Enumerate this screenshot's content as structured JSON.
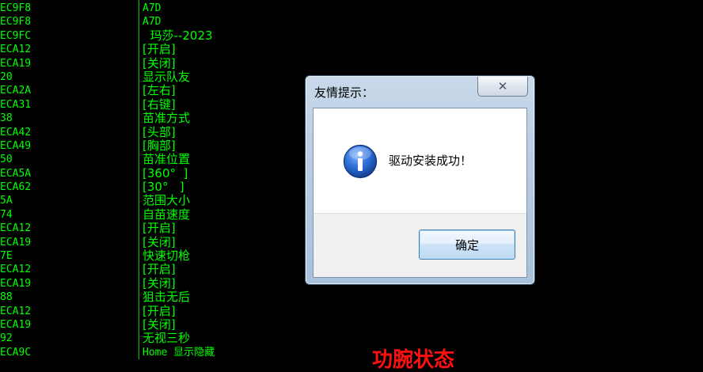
{
  "console": {
    "left_column": [
      "EC9F8",
      "EC9F8",
      "EC9FC",
      "ECA12",
      "ECA19",
      "20",
      "ECA2A",
      "ECA31",
      "38",
      "ECA42",
      "ECA49",
      "50",
      "ECA5A",
      "ECA62",
      "5A",
      "74",
      "ECA12",
      "ECA19",
      "7E",
      "ECA12",
      "ECA19",
      "88",
      "ECA12",
      "ECA19",
      "92",
      "ECA9C"
    ],
    "right_column": [
      "A7D",
      "A7D",
      "  玛莎--2023",
      "[开启]",
      "[关闭]",
      "显示队友",
      "[左右]",
      "[右键]",
      "苗准方式",
      "[头部]",
      "[胸部]",
      "苗准位置",
      "[360°  ]",
      "[30°   ]",
      "范围大小",
      "自苗速度",
      "[开启]",
      "[关闭]",
      "快速切枪",
      "[开启]",
      "[关闭]",
      "狙击无后",
      "[开启]",
      "[关闭]",
      "无视三秒",
      "Home 显示隐藏"
    ],
    "red_fragment": "功腕状态"
  },
  "dialog": {
    "title": "友情提示：",
    "close_symbol": "✕",
    "message": "驱动安装成功！",
    "ok_label": "确定",
    "icon": "info-icon",
    "colors": {
      "console_text": "#00ff00",
      "ok_border": "#3c7fb1",
      "icon_blue": "#1d5fc4"
    }
  }
}
